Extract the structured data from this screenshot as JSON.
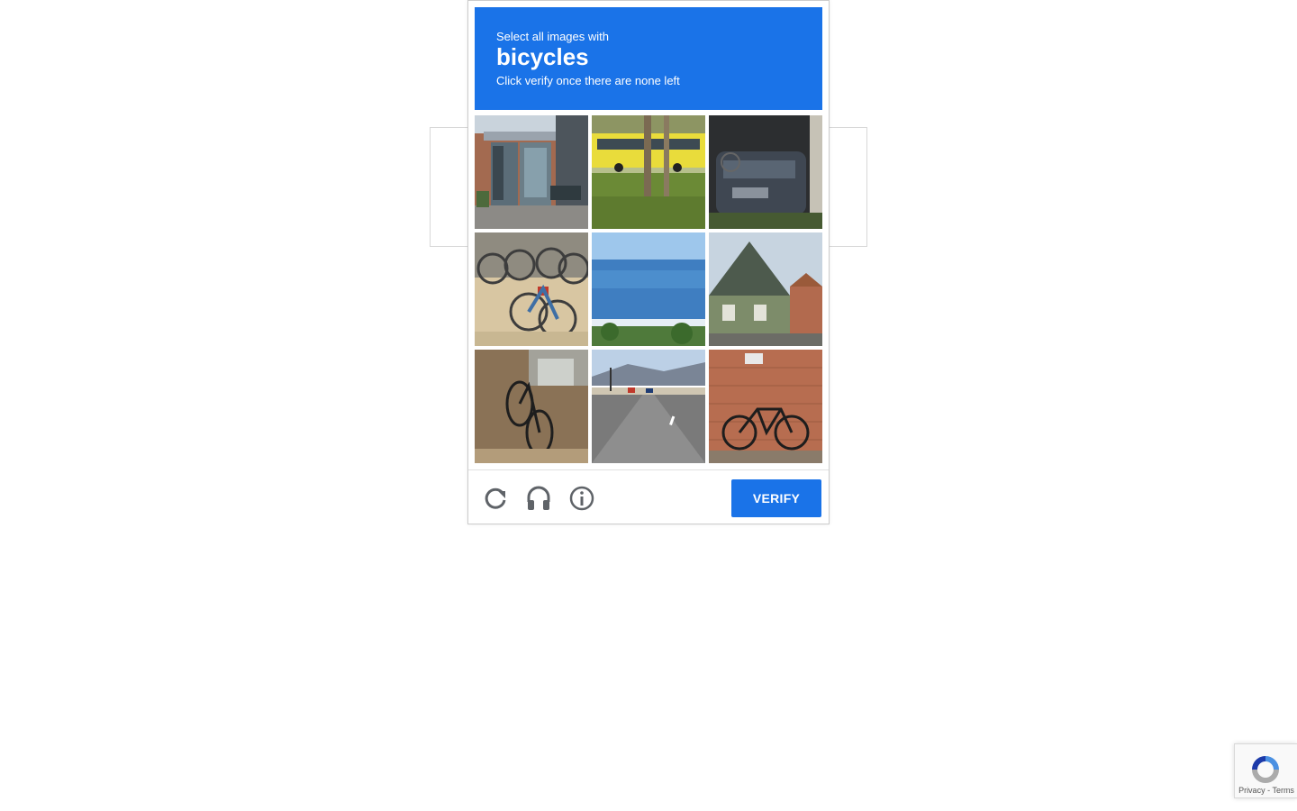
{
  "challenge": {
    "instruction": "Select all images with",
    "keyword": "bicycles",
    "subtext": "Click verify once there are none left",
    "verify_label": "VERIFY",
    "header_color": "#1a73e8",
    "tiles": [
      {
        "name": "tile-building-entrance"
      },
      {
        "name": "tile-yellow-bus-tree"
      },
      {
        "name": "tile-car-garage"
      },
      {
        "name": "tile-bike-rack"
      },
      {
        "name": "tile-ocean-view"
      },
      {
        "name": "tile-old-house"
      },
      {
        "name": "tile-bicycle-sidewalk"
      },
      {
        "name": "tile-road"
      },
      {
        "name": "tile-bicycle-wall"
      }
    ],
    "icons": {
      "reload": "reload-icon",
      "audio": "headphones-icon",
      "info": "info-icon"
    }
  },
  "recaptcha_badge": {
    "privacy": "Privacy",
    "separator": "-",
    "terms": "Terms"
  }
}
